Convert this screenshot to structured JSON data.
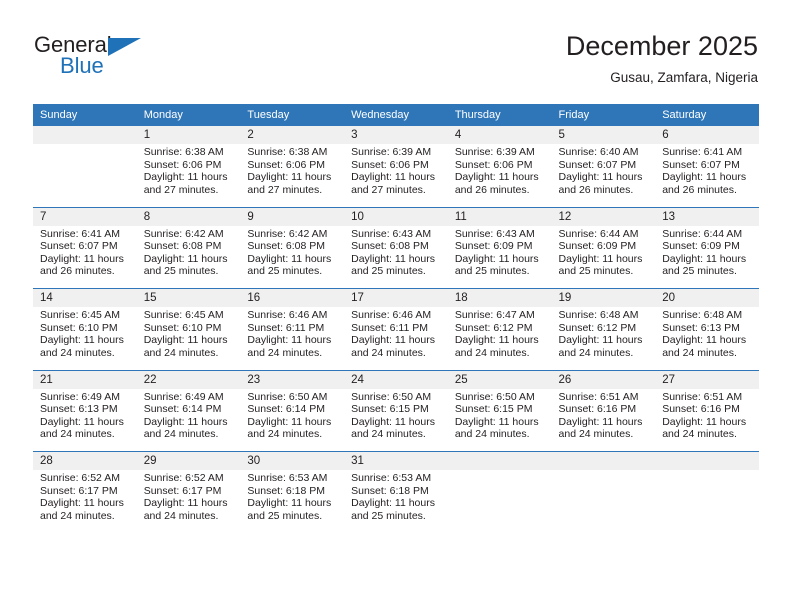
{
  "brand": {
    "name_part1": "General",
    "name_part2": "Blue",
    "accent_color": "#1f72b8"
  },
  "header": {
    "title": "December 2025",
    "subtitle": "Gusau, Zamfara, Nigeria"
  },
  "theme": {
    "header_blue": "#2f76b8",
    "daynum_band": "#f0f0f0",
    "text": "#231f20"
  },
  "calendar": {
    "weekday_headers": [
      "Sunday",
      "Monday",
      "Tuesday",
      "Wednesday",
      "Thursday",
      "Friday",
      "Saturday"
    ],
    "weeks": [
      [
        {
          "day": "",
          "sunrise": "",
          "sunset": "",
          "daylight_line1": "",
          "daylight_line2": ""
        },
        {
          "day": "1",
          "sunrise": "Sunrise: 6:38 AM",
          "sunset": "Sunset: 6:06 PM",
          "daylight_line1": "Daylight: 11 hours",
          "daylight_line2": "and 27 minutes."
        },
        {
          "day": "2",
          "sunrise": "Sunrise: 6:38 AM",
          "sunset": "Sunset: 6:06 PM",
          "daylight_line1": "Daylight: 11 hours",
          "daylight_line2": "and 27 minutes."
        },
        {
          "day": "3",
          "sunrise": "Sunrise: 6:39 AM",
          "sunset": "Sunset: 6:06 PM",
          "daylight_line1": "Daylight: 11 hours",
          "daylight_line2": "and 27 minutes."
        },
        {
          "day": "4",
          "sunrise": "Sunrise: 6:39 AM",
          "sunset": "Sunset: 6:06 PM",
          "daylight_line1": "Daylight: 11 hours",
          "daylight_line2": "and 26 minutes."
        },
        {
          "day": "5",
          "sunrise": "Sunrise: 6:40 AM",
          "sunset": "Sunset: 6:07 PM",
          "daylight_line1": "Daylight: 11 hours",
          "daylight_line2": "and 26 minutes."
        },
        {
          "day": "6",
          "sunrise": "Sunrise: 6:41 AM",
          "sunset": "Sunset: 6:07 PM",
          "daylight_line1": "Daylight: 11 hours",
          "daylight_line2": "and 26 minutes."
        }
      ],
      [
        {
          "day": "7",
          "sunrise": "Sunrise: 6:41 AM",
          "sunset": "Sunset: 6:07 PM",
          "daylight_line1": "Daylight: 11 hours",
          "daylight_line2": "and 26 minutes."
        },
        {
          "day": "8",
          "sunrise": "Sunrise: 6:42 AM",
          "sunset": "Sunset: 6:08 PM",
          "daylight_line1": "Daylight: 11 hours",
          "daylight_line2": "and 25 minutes."
        },
        {
          "day": "9",
          "sunrise": "Sunrise: 6:42 AM",
          "sunset": "Sunset: 6:08 PM",
          "daylight_line1": "Daylight: 11 hours",
          "daylight_line2": "and 25 minutes."
        },
        {
          "day": "10",
          "sunrise": "Sunrise: 6:43 AM",
          "sunset": "Sunset: 6:08 PM",
          "daylight_line1": "Daylight: 11 hours",
          "daylight_line2": "and 25 minutes."
        },
        {
          "day": "11",
          "sunrise": "Sunrise: 6:43 AM",
          "sunset": "Sunset: 6:09 PM",
          "daylight_line1": "Daylight: 11 hours",
          "daylight_line2": "and 25 minutes."
        },
        {
          "day": "12",
          "sunrise": "Sunrise: 6:44 AM",
          "sunset": "Sunset: 6:09 PM",
          "daylight_line1": "Daylight: 11 hours",
          "daylight_line2": "and 25 minutes."
        },
        {
          "day": "13",
          "sunrise": "Sunrise: 6:44 AM",
          "sunset": "Sunset: 6:09 PM",
          "daylight_line1": "Daylight: 11 hours",
          "daylight_line2": "and 25 minutes."
        }
      ],
      [
        {
          "day": "14",
          "sunrise": "Sunrise: 6:45 AM",
          "sunset": "Sunset: 6:10 PM",
          "daylight_line1": "Daylight: 11 hours",
          "daylight_line2": "and 24 minutes."
        },
        {
          "day": "15",
          "sunrise": "Sunrise: 6:45 AM",
          "sunset": "Sunset: 6:10 PM",
          "daylight_line1": "Daylight: 11 hours",
          "daylight_line2": "and 24 minutes."
        },
        {
          "day": "16",
          "sunrise": "Sunrise: 6:46 AM",
          "sunset": "Sunset: 6:11 PM",
          "daylight_line1": "Daylight: 11 hours",
          "daylight_line2": "and 24 minutes."
        },
        {
          "day": "17",
          "sunrise": "Sunrise: 6:46 AM",
          "sunset": "Sunset: 6:11 PM",
          "daylight_line1": "Daylight: 11 hours",
          "daylight_line2": "and 24 minutes."
        },
        {
          "day": "18",
          "sunrise": "Sunrise: 6:47 AM",
          "sunset": "Sunset: 6:12 PM",
          "daylight_line1": "Daylight: 11 hours",
          "daylight_line2": "and 24 minutes."
        },
        {
          "day": "19",
          "sunrise": "Sunrise: 6:48 AM",
          "sunset": "Sunset: 6:12 PM",
          "daylight_line1": "Daylight: 11 hours",
          "daylight_line2": "and 24 minutes."
        },
        {
          "day": "20",
          "sunrise": "Sunrise: 6:48 AM",
          "sunset": "Sunset: 6:13 PM",
          "daylight_line1": "Daylight: 11 hours",
          "daylight_line2": "and 24 minutes."
        }
      ],
      [
        {
          "day": "21",
          "sunrise": "Sunrise: 6:49 AM",
          "sunset": "Sunset: 6:13 PM",
          "daylight_line1": "Daylight: 11 hours",
          "daylight_line2": "and 24 minutes."
        },
        {
          "day": "22",
          "sunrise": "Sunrise: 6:49 AM",
          "sunset": "Sunset: 6:14 PM",
          "daylight_line1": "Daylight: 11 hours",
          "daylight_line2": "and 24 minutes."
        },
        {
          "day": "23",
          "sunrise": "Sunrise: 6:50 AM",
          "sunset": "Sunset: 6:14 PM",
          "daylight_line1": "Daylight: 11 hours",
          "daylight_line2": "and 24 minutes."
        },
        {
          "day": "24",
          "sunrise": "Sunrise: 6:50 AM",
          "sunset": "Sunset: 6:15 PM",
          "daylight_line1": "Daylight: 11 hours",
          "daylight_line2": "and 24 minutes."
        },
        {
          "day": "25",
          "sunrise": "Sunrise: 6:50 AM",
          "sunset": "Sunset: 6:15 PM",
          "daylight_line1": "Daylight: 11 hours",
          "daylight_line2": "and 24 minutes."
        },
        {
          "day": "26",
          "sunrise": "Sunrise: 6:51 AM",
          "sunset": "Sunset: 6:16 PM",
          "daylight_line1": "Daylight: 11 hours",
          "daylight_line2": "and 24 minutes."
        },
        {
          "day": "27",
          "sunrise": "Sunrise: 6:51 AM",
          "sunset": "Sunset: 6:16 PM",
          "daylight_line1": "Daylight: 11 hours",
          "daylight_line2": "and 24 minutes."
        }
      ],
      [
        {
          "day": "28",
          "sunrise": "Sunrise: 6:52 AM",
          "sunset": "Sunset: 6:17 PM",
          "daylight_line1": "Daylight: 11 hours",
          "daylight_line2": "and 24 minutes."
        },
        {
          "day": "29",
          "sunrise": "Sunrise: 6:52 AM",
          "sunset": "Sunset: 6:17 PM",
          "daylight_line1": "Daylight: 11 hours",
          "daylight_line2": "and 24 minutes."
        },
        {
          "day": "30",
          "sunrise": "Sunrise: 6:53 AM",
          "sunset": "Sunset: 6:18 PM",
          "daylight_line1": "Daylight: 11 hours",
          "daylight_line2": "and 25 minutes."
        },
        {
          "day": "31",
          "sunrise": "Sunrise: 6:53 AM",
          "sunset": "Sunset: 6:18 PM",
          "daylight_line1": "Daylight: 11 hours",
          "daylight_line2": "and 25 minutes."
        },
        {
          "day": "",
          "sunrise": "",
          "sunset": "",
          "daylight_line1": "",
          "daylight_line2": ""
        },
        {
          "day": "",
          "sunrise": "",
          "sunset": "",
          "daylight_line1": "",
          "daylight_line2": ""
        },
        {
          "day": "",
          "sunrise": "",
          "sunset": "",
          "daylight_line1": "",
          "daylight_line2": ""
        }
      ]
    ]
  }
}
